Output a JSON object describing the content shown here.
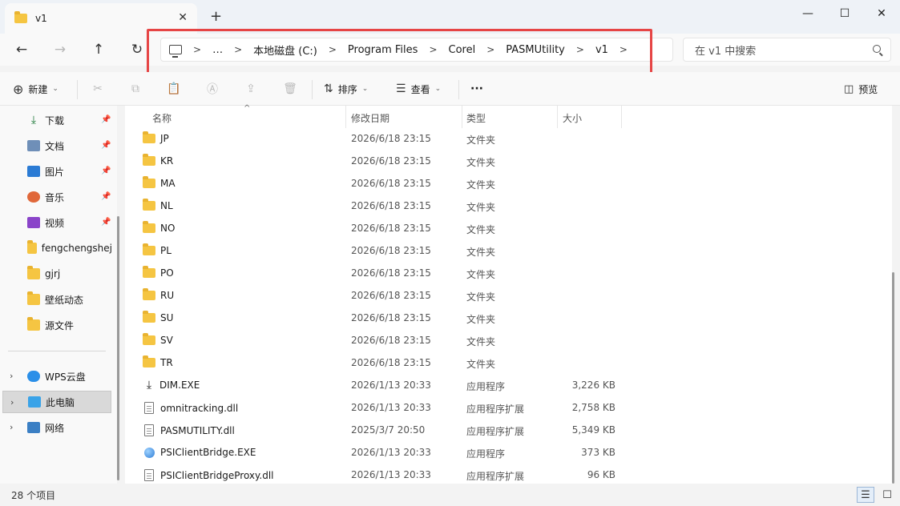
{
  "window": {
    "tab_title": "v1",
    "new_tab": "+",
    "tab_close": "✕",
    "minimize": "—",
    "maximize": "☐",
    "close": "✕"
  },
  "nav": {
    "back": "←",
    "forward": "→",
    "up": "↑",
    "refresh": "↻",
    "breadcrumbs": [
      "…",
      "本地磁盘 (C:)",
      "Program Files",
      "Corel",
      "PASMUtility",
      "v1"
    ],
    "separator": ">",
    "search_placeholder": "在 v1 中搜索"
  },
  "toolbar": {
    "new_label": "新建",
    "sort_label": "排序",
    "view_label": "查看",
    "more_label": "···",
    "preview_label": "预览"
  },
  "sidebar": {
    "quick": [
      {
        "label": "下载",
        "icon": "download-icon"
      },
      {
        "label": "文档",
        "icon": "document-icon"
      },
      {
        "label": "图片",
        "icon": "pictures-icon"
      },
      {
        "label": "音乐",
        "icon": "music-icon"
      },
      {
        "label": "视频",
        "icon": "video-icon"
      },
      {
        "label": "fengchengshej",
        "icon": "folder-icon"
      },
      {
        "label": "gjrj",
        "icon": "folder-icon"
      },
      {
        "label": "壁纸动态",
        "icon": "folder-icon"
      },
      {
        "label": "源文件",
        "icon": "folder-icon"
      }
    ],
    "locations": [
      {
        "label": "WPS云盘",
        "icon": "cloud-icon"
      },
      {
        "label": "此电脑",
        "icon": "computer-icon",
        "selected": true
      },
      {
        "label": "网络",
        "icon": "network-icon"
      }
    ]
  },
  "columns": {
    "name": "名称",
    "date": "修改日期",
    "type": "类型",
    "size": "大小"
  },
  "files": [
    {
      "name": "JP",
      "date": "2026/6/18 23:15",
      "type": "文件夹",
      "size": "",
      "kind": "folder"
    },
    {
      "name": "KR",
      "date": "2026/6/18 23:15",
      "type": "文件夹",
      "size": "",
      "kind": "folder"
    },
    {
      "name": "MA",
      "date": "2026/6/18 23:15",
      "type": "文件夹",
      "size": "",
      "kind": "folder"
    },
    {
      "name": "NL",
      "date": "2026/6/18 23:15",
      "type": "文件夹",
      "size": "",
      "kind": "folder"
    },
    {
      "name": "NO",
      "date": "2026/6/18 23:15",
      "type": "文件夹",
      "size": "",
      "kind": "folder"
    },
    {
      "name": "PL",
      "date": "2026/6/18 23:15",
      "type": "文件夹",
      "size": "",
      "kind": "folder"
    },
    {
      "name": "PO",
      "date": "2026/6/18 23:15",
      "type": "文件夹",
      "size": "",
      "kind": "folder"
    },
    {
      "name": "RU",
      "date": "2026/6/18 23:15",
      "type": "文件夹",
      "size": "",
      "kind": "folder"
    },
    {
      "name": "SU",
      "date": "2026/6/18 23:15",
      "type": "文件夹",
      "size": "",
      "kind": "folder"
    },
    {
      "name": "SV",
      "date": "2026/6/18 23:15",
      "type": "文件夹",
      "size": "",
      "kind": "folder"
    },
    {
      "name": "TR",
      "date": "2026/6/18 23:15",
      "type": "文件夹",
      "size": "",
      "kind": "folder"
    },
    {
      "name": "DIM.EXE",
      "date": "2026/1/13 20:33",
      "type": "应用程序",
      "size": "3,226 KB",
      "kind": "exe"
    },
    {
      "name": "omnitracking.dll",
      "date": "2026/1/13 20:33",
      "type": "应用程序扩展",
      "size": "2,758 KB",
      "kind": "dll"
    },
    {
      "name": "PASMUTILITY.dll",
      "date": "2025/3/7 20:50",
      "type": "应用程序扩展",
      "size": "5,349 KB",
      "kind": "dll"
    },
    {
      "name": "PSIClientBridge.EXE",
      "date": "2026/1/13 20:33",
      "type": "应用程序",
      "size": "373 KB",
      "kind": "globe"
    },
    {
      "name": "PSIClientBridgeProxy.dll",
      "date": "2026/1/13 20:33",
      "type": "应用程序扩展",
      "size": "96 KB",
      "kind": "dll"
    }
  ],
  "status": {
    "count": "28 个项目"
  },
  "colors": {
    "highlight": "#e64545",
    "folder": "#f5c542"
  }
}
